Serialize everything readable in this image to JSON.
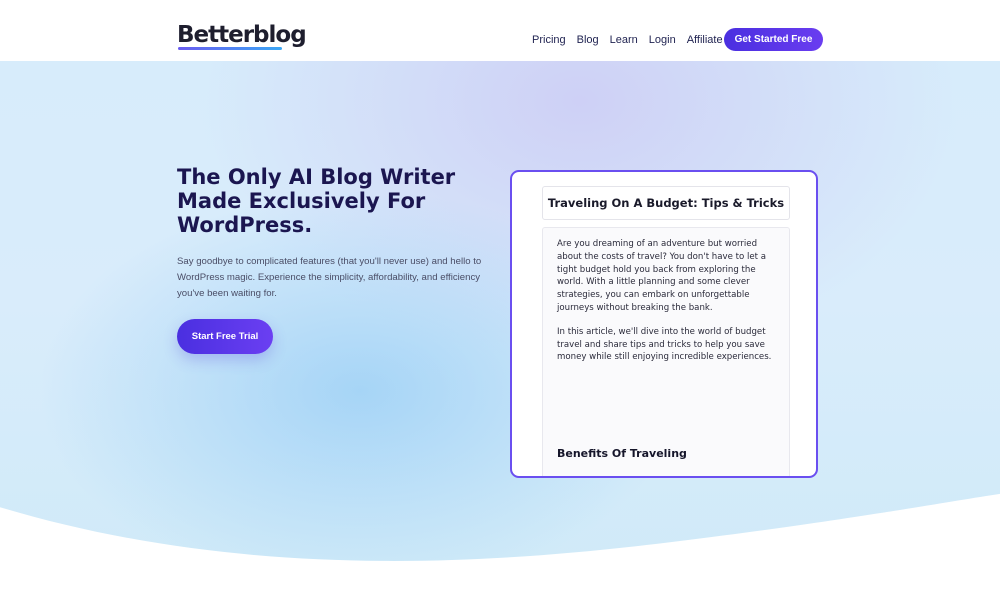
{
  "header": {
    "logo": "Betterblog",
    "nav": [
      "Pricing",
      "Blog",
      "Learn",
      "Login",
      "Affiliate"
    ],
    "cta_label": "Get Started Free"
  },
  "hero": {
    "headline": "The Only AI Blog Writer Made Exclusively For WordPress.",
    "subtext": "Say goodbye to complicated features (that you'll never use) and hello to WordPress magic. Experience the simplicity, affordability, and efficiency you've been waiting for.",
    "cta_label": "Start Free Trial"
  },
  "preview": {
    "title": "Traveling On A Budget: Tips & Tricks",
    "paragraphs": [
      "Are you dreaming of an adventure but worried about the costs of travel? You don't have to let a tight budget hold you back from exploring the world. With a little planning and some clever strategies, you can embark on unforgettable journeys without breaking the bank.",
      "In this article, we'll dive into the world of budget travel and share tips and tricks to help you save money while still enjoying incredible experiences."
    ],
    "subheading": "Benefits Of Traveling"
  },
  "colors": {
    "accent": "#4a2fe0",
    "headline": "#1b1650",
    "preview_border": "#6a4ff0"
  }
}
